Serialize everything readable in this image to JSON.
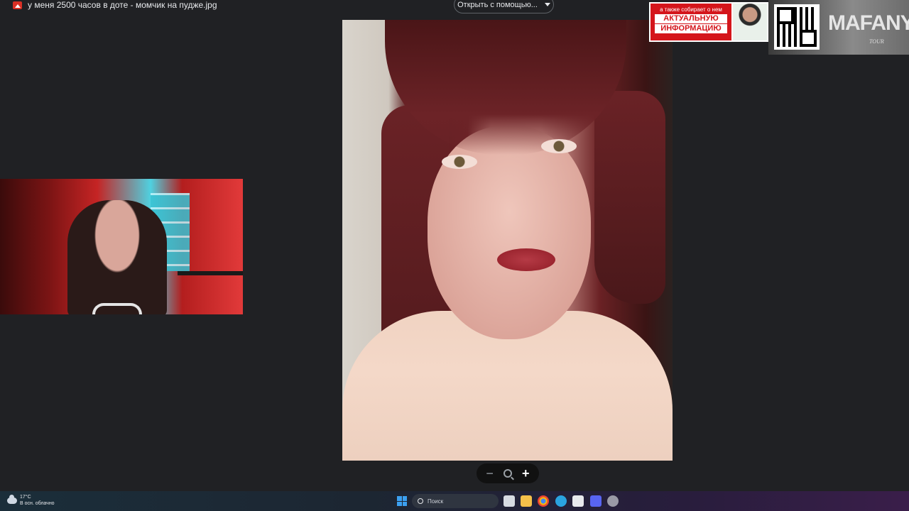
{
  "window": {
    "file_title": "у меня 2500 часов в доте - момчик на пудже.jpg",
    "open_with_label": "Открыть с помощью..."
  },
  "zoom_controls": {
    "zoom_out_label": "−",
    "zoom_in_label": "+"
  },
  "overlay_banner": {
    "line1": "а также собирает о нем",
    "line2": "АКТУАЛЬНУЮ",
    "line3": "ИНФОРМАЦИЮ"
  },
  "promo": {
    "title": "MAFANYA",
    "subtitle": "TOUR"
  },
  "taskbar": {
    "weather_temp": "17°C",
    "weather_desc": "В осн. облачно",
    "search_placeholder": "Поиск"
  },
  "colors": {
    "viewer_bg": "#202124",
    "banner_red": "#d4151b",
    "start_blue": "#3ca0f0"
  }
}
